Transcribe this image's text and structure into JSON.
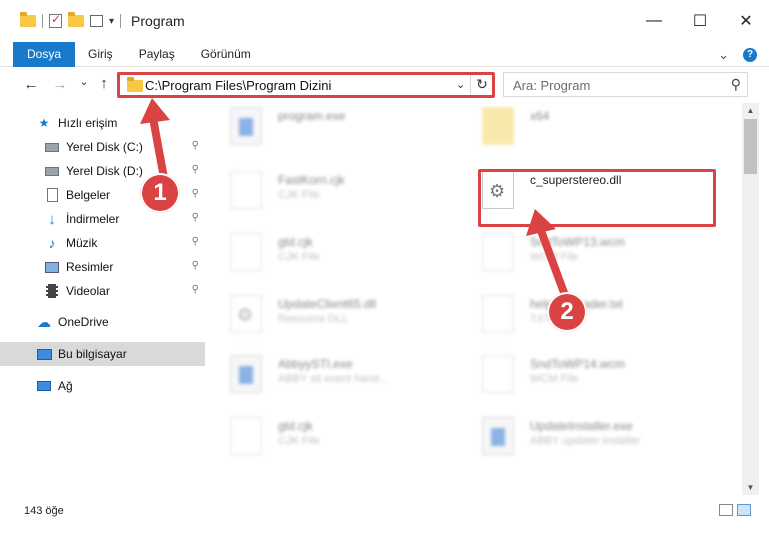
{
  "window": {
    "title": "Program",
    "minimize_symbol": "—",
    "maximize_symbol": "☐",
    "close_symbol": "✕"
  },
  "quick_access_toolbar": {
    "icons": [
      "folder-icon",
      "properties-check-icon",
      "new-folder-icon",
      "customize-icon"
    ],
    "dropdown_symbol": "▾"
  },
  "ribbon": {
    "tabs": [
      {
        "label": "Dosya",
        "active": true
      },
      {
        "label": "Giriş",
        "active": false
      },
      {
        "label": "Paylaş",
        "active": false
      },
      {
        "label": "Görünüm",
        "active": false
      }
    ],
    "collapse_symbol": "⌄",
    "help_symbol": "?"
  },
  "nav": {
    "back_symbol": "←",
    "forward_symbol": "→",
    "recent_symbol": "⌄",
    "up_symbol": "↑",
    "address": "C:\\Program Files\\Program Dizini",
    "address_dropdown_symbol": "⌄",
    "refresh_symbol": "↻",
    "search_placeholder": "Ara: Program",
    "search_symbol": "⚲"
  },
  "sidebar": {
    "items": [
      {
        "label": "Hızlı erişim",
        "icon": "star-icon",
        "pinned": false
      },
      {
        "label": "Yerel Disk (C:)",
        "icon": "drive-icon",
        "pinned": true
      },
      {
        "label": "Yerel Disk (D:)",
        "icon": "drive-icon",
        "pinned": true
      },
      {
        "label": "Belgeler",
        "icon": "documents-icon",
        "pinned": true
      },
      {
        "label": "İndirmeler",
        "icon": "download-icon",
        "pinned": true
      },
      {
        "label": "Müzik",
        "icon": "music-icon",
        "pinned": true
      },
      {
        "label": "Resimler",
        "icon": "pictures-icon",
        "pinned": true
      },
      {
        "label": "Videolar",
        "icon": "videos-icon",
        "pinned": true
      },
      {
        "label": "OneDrive",
        "icon": "cloud-icon",
        "pinned": false
      },
      {
        "label": "Bu bilgisayar",
        "icon": "computer-icon",
        "pinned": false,
        "selected": true
      },
      {
        "label": "Ağ",
        "icon": "network-icon",
        "pinned": false
      }
    ],
    "pin_symbol": "📌"
  },
  "files": [
    {
      "name": "program.exe",
      "type": "",
      "icon": "exe-icon",
      "blurred": true
    },
    {
      "name": "x64",
      "type": "",
      "icon": "folder-icon",
      "blurred": true
    },
    {
      "name": "FastKorn.cjk",
      "type": "CJK File",
      "icon": "file-icon",
      "blurred": true
    },
    {
      "name": "c_superstereo.dll",
      "type": "",
      "icon": "dll-gears-icon",
      "blurred": false
    },
    {
      "name": "gtd.cjk",
      "type": "CJK File",
      "icon": "file-icon",
      "blurred": true
    },
    {
      "name": "SndToWP13.wcm",
      "type": "WCM File",
      "icon": "file-icon",
      "blurred": true
    },
    {
      "name": "UpdateClient65.dll",
      "type": "Resource DLL",
      "icon": "dll-icon",
      "blurred": true
    },
    {
      "name": "helpfileReader.txt",
      "type": "TXT File",
      "icon": "file-icon",
      "blurred": true
    },
    {
      "name": "AbbyySTI.exe",
      "type": "ABBY sti event hand...",
      "icon": "app-icon",
      "blurred": true
    },
    {
      "name": "SndToWP14.wcm",
      "type": "WCM File",
      "icon": "file-icon",
      "blurred": true
    },
    {
      "name": "gtd.cjk",
      "type": "CJK File",
      "icon": "file-icon",
      "blurred": true
    },
    {
      "name": "UpdateInstaller.exe",
      "type": "ABBY updater installer",
      "icon": "app-icon",
      "blurred": true
    }
  ],
  "callouts": [
    "1",
    "2"
  ],
  "status": {
    "item_count": "143 öğe"
  },
  "colors": {
    "accent": "#1979ca",
    "highlight": "#d94343",
    "selected_bg": "#d9d9d9"
  }
}
